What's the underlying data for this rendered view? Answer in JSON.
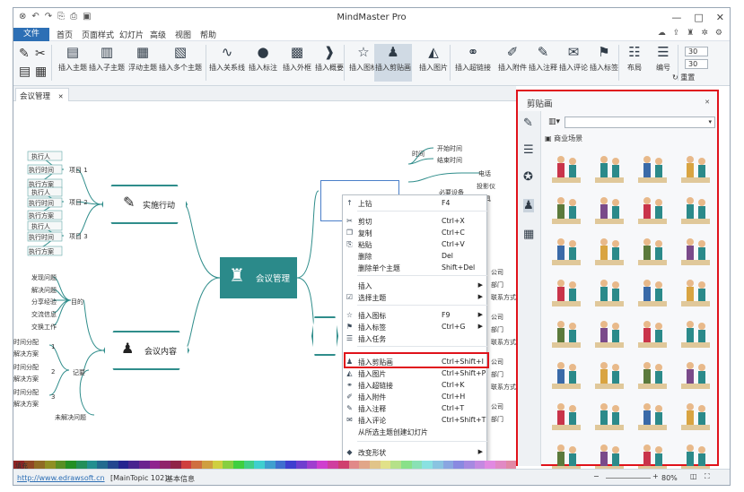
{
  "window": {
    "title": "MindMaster Pro",
    "quick_access": [
      "↶",
      "↷",
      "⎘",
      "⎙",
      "▣"
    ],
    "controls": [
      "—",
      "□",
      "✕"
    ]
  },
  "menubar": {
    "file": "文件",
    "items": [
      "首页",
      "页面样式",
      "幻灯片",
      "高级",
      "视图",
      "帮助"
    ],
    "right_icons": [
      "cloud-icon",
      "share-icon",
      "shirt-icon",
      "apps-icon",
      "settings-icon"
    ]
  },
  "ribbon": {
    "buttons": [
      {
        "label": "插入主题",
        "icon": "▤"
      },
      {
        "label": "插入子主题",
        "icon": "▥"
      },
      {
        "label": "浮动主题",
        "icon": "▦"
      },
      {
        "label": "插入多个主题",
        "icon": "▧"
      },
      {
        "label": "插入关系线",
        "icon": "∿"
      },
      {
        "label": "插入标注",
        "icon": "●"
      },
      {
        "label": "插入外框",
        "icon": "▩"
      },
      {
        "label": "插入概要",
        "icon": "❱"
      },
      {
        "label": "插入图标",
        "icon": "☆"
      },
      {
        "label": "插入剪贴画",
        "icon": "♟"
      },
      {
        "label": "插入图片",
        "icon": "◭"
      },
      {
        "label": "插入超链接",
        "icon": "⚭"
      },
      {
        "label": "插入附件",
        "icon": "✐"
      },
      {
        "label": "插入注释",
        "icon": "✎"
      },
      {
        "label": "插入评论",
        "icon": "✉"
      },
      {
        "label": "插入标签",
        "icon": "⚑"
      },
      {
        "label": "布局",
        "icon": "☷"
      },
      {
        "label": "编号",
        "icon": "☰"
      }
    ],
    "spin_values": [
      "30",
      "30"
    ],
    "reset_label": "重置"
  },
  "document_tab": {
    "label": "会议管理",
    "close": "✕"
  },
  "mindmap": {
    "central": "会议管理",
    "left_branch_1": "实施行动",
    "left_branch_2": "会议内容",
    "left_items_1": [
      {
        "label": "执行人"
      },
      {
        "label": "执行时间"
      },
      {
        "label": "执行方案"
      },
      {
        "label": "执行人"
      },
      {
        "label": "执行时间"
      },
      {
        "label": "执行方案"
      },
      {
        "label": "执行人"
      },
      {
        "label": "执行时间"
      },
      {
        "label": "执行方案"
      }
    ],
    "left_projects": [
      "项目 1",
      "项目 2",
      "项目 3"
    ],
    "left_items_2": [
      "发现问题",
      "解决问题",
      "分享经验",
      "交流信息",
      "交换工作"
    ],
    "goal_label": "目的",
    "period_items": [
      "时间分配",
      "解决方案",
      "时间分配",
      "解决方案",
      "时间分配",
      "解决方案"
    ],
    "period_labels": [
      "1",
      "2",
      "3"
    ],
    "record_label": "记要",
    "unsolved": "未解决问题",
    "right_items": [
      "时间",
      "开始时间",
      "结束时间",
      "必要设备",
      "电话",
      "投影仪",
      "文具"
    ],
    "right_small": [
      "公司",
      "部门",
      "联系方式",
      "公司",
      "部门",
      "联系方式",
      "公司",
      "部门",
      "联系方式",
      "公司",
      "部门"
    ]
  },
  "context_menu": {
    "items": [
      {
        "label": "上钻",
        "key": "F4",
        "icon": "↑"
      },
      {
        "label": "剪切",
        "key": "Ctrl+X",
        "icon": "✂"
      },
      {
        "label": "复制",
        "key": "Ctrl+C",
        "icon": "❐"
      },
      {
        "label": "粘贴",
        "key": "Ctrl+V",
        "icon": "⎘"
      },
      {
        "label": "删除",
        "key": "Del",
        "icon": ""
      },
      {
        "label": "删除单个主题",
        "key": "Shift+Del",
        "icon": ""
      },
      {
        "label": "插入",
        "key": "",
        "icon": "",
        "sub": true
      },
      {
        "label": "选择主题",
        "key": "",
        "icon": "☑",
        "sub": true
      },
      {
        "label": "插入图标",
        "key": "F9",
        "icon": "☆",
        "sub": true
      },
      {
        "label": "插入标签",
        "key": "Ctrl+G",
        "icon": "⚑",
        "sub": true
      },
      {
        "label": "插入任务",
        "key": "",
        "icon": "☰"
      },
      {
        "label": "插入剪贴画",
        "key": "Ctrl+Shift+I",
        "icon": "♟"
      },
      {
        "label": "插入图片",
        "key": "Ctrl+Shift+P",
        "icon": "◭"
      },
      {
        "label": "插入超链接",
        "key": "Ctrl+K",
        "icon": "⚭"
      },
      {
        "label": "插入附件",
        "key": "Ctrl+H",
        "icon": "✐"
      },
      {
        "label": "插入注释",
        "key": "Ctrl+T",
        "icon": "✎"
      },
      {
        "label": "插入评论",
        "key": "Ctrl+Shift+T",
        "icon": "✉"
      },
      {
        "label": "从所选主题创建幻灯片",
        "key": "",
        "icon": ""
      },
      {
        "label": "改变形状",
        "key": "",
        "icon": "◆",
        "sub": true
      }
    ]
  },
  "clipart_panel": {
    "title": "剪贴画",
    "close": "✕",
    "category": "商业场景",
    "side_icons": [
      "brush-icon",
      "list-icon",
      "star-icon",
      "clipart-icon",
      "calendar-icon"
    ]
  },
  "statusbar": {
    "fill_label": "填充",
    "link": "http://www.edrawsoft.cn",
    "topic": "[MainTopic 102]",
    "info": "基本信息",
    "zoom": "80%"
  },
  "colors": {
    "accent": "#2d6fb5",
    "teal": "#2b8a8a",
    "highlight": "#e0121b"
  }
}
